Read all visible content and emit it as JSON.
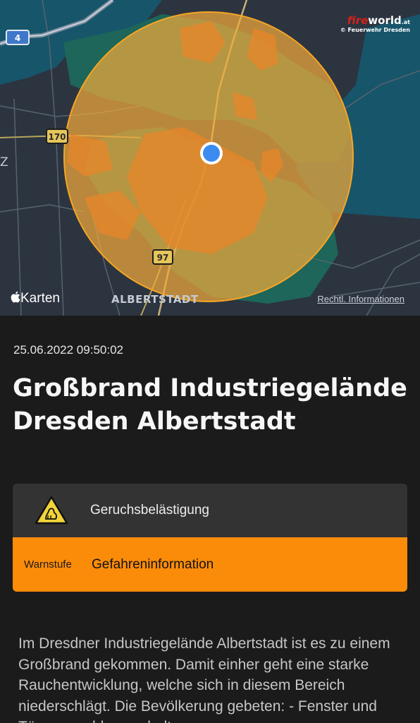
{
  "map": {
    "watermark_brand_fire": "fire",
    "watermark_brand_world": "world",
    "watermark_brand_tld": ".at",
    "watermark_credit": "© Feuerwehr Dresden",
    "road_shields": [
      "4",
      "170",
      "97"
    ],
    "side_label": "Z",
    "maps_logo_text": "Karten",
    "district_label": "ALBERTSTADT",
    "legal_link": "Rechtl. Informationen",
    "colors": {
      "water": "#17556a",
      "land": "#2c3440",
      "warning_area": "#f0a93a",
      "location_dot": "#3b8bf0"
    }
  },
  "warning": {
    "timestamp": "25.06.2022 09:50:02",
    "title": "Großbrand Industriegelände Dresden Albertstadt",
    "event": "Geruchsbelästigung",
    "event_icon": "odor-warning-icon",
    "level_label": "Warnstufe",
    "level_value": "Gefahreninformation",
    "level_color": "#fb8c0a",
    "description": "Im Dresdner Industriegelände Albertstadt ist es zu einem Großbrand gekommen. Damit einher geht eine starke Rauchentwicklung, welche sich in diesem Bereich niederschlägt. Die Bevölkerung gebeten: - Fenster und Türen geschlossen halten"
  }
}
